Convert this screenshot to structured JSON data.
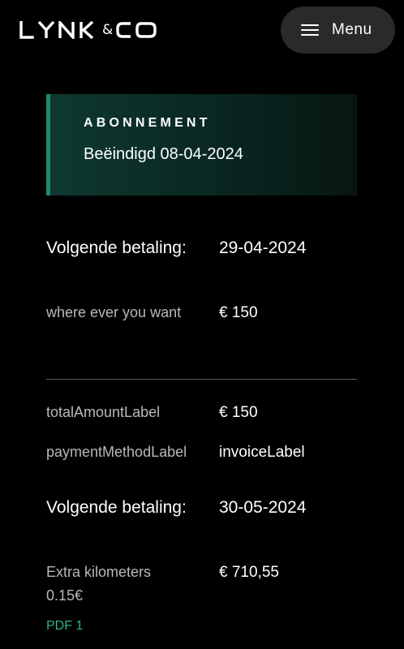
{
  "header": {
    "logo_text": "LYNK&CO",
    "logo_amp": "&",
    "menu_label": "Menu"
  },
  "subscription": {
    "title": "ABONNEMENT",
    "status": "Beëindigd 08-04-2024"
  },
  "payments": [
    {
      "label": "Volgende betaling:",
      "date": "29-04-2024",
      "item_label": "where ever you want",
      "item_amount": "€ 150"
    },
    {
      "label": "Volgende betaling:",
      "date": "30-05-2024",
      "item_label": "Extra kilometers 0.15€",
      "item_amount": "€ 710,55"
    }
  ],
  "summary": {
    "total_label": "totalAmountLabel",
    "total_value": "€ 150",
    "method_label": "paymentMethodLabel",
    "method_value": "invoiceLabel"
  },
  "pdf_link": "PDF 1",
  "colors": {
    "background": "#000000",
    "accent_green": "#1d8b6e",
    "link_green": "#2bb58f",
    "menu_bg": "#2a2a2a"
  }
}
